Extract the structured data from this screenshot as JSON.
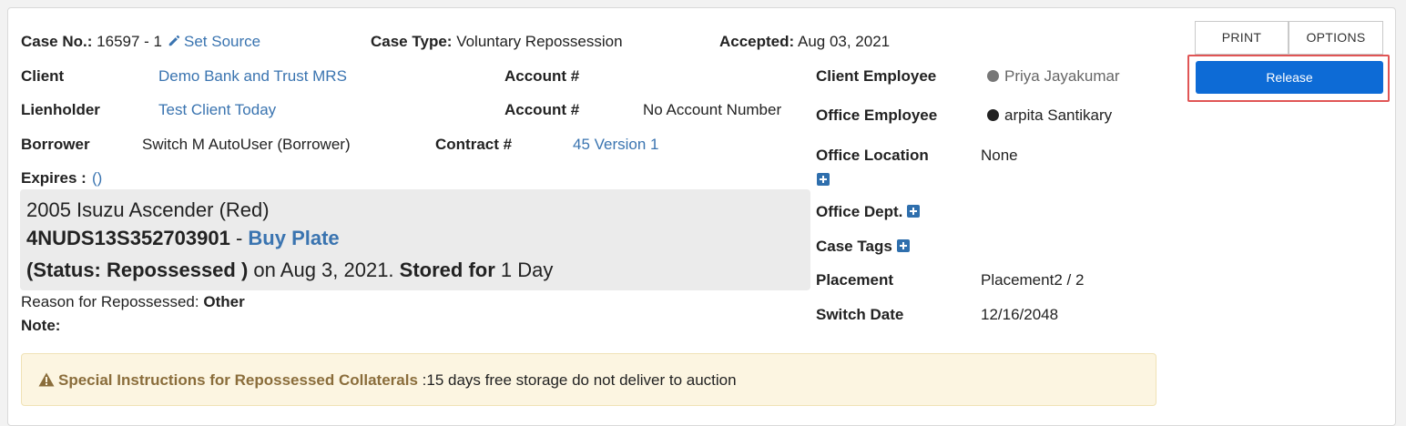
{
  "case": {
    "case_no_label": "Case No.:",
    "case_no_value": "16597 - 1",
    "set_source_label": "Set Source",
    "case_type_label": "Case Type:",
    "case_type_value": "Voluntary Repossession",
    "accepted_label": "Accepted:",
    "accepted_value": "Aug 03, 2021"
  },
  "left": {
    "client_label": "Client",
    "client_value": "Demo Bank and Trust MRS",
    "lienholder_label": "Lienholder",
    "lienholder_value": "Test Client Today",
    "borrower_label": "Borrower",
    "borrower_value": "Switch M AutoUser (Borrower)",
    "expires_label": "Expires :",
    "expires_value": "()"
  },
  "middle": {
    "account1_label": "Account #",
    "account1_value": "",
    "account2_label": "Account #",
    "account2_value": "No Account Number",
    "contract_label": "Contract #",
    "contract_value": "45 Version 1"
  },
  "vehicle": {
    "title": "2005 Isuzu Ascender (Red)",
    "vin": "4NUDS13S352703901",
    "dash": " - ",
    "buy_plate": "Buy Plate",
    "status": "(Status: Repossessed )",
    "on_date": " on Aug 3, 2021. ",
    "stored_label": "Stored for",
    "stored_value": " 1 Day"
  },
  "reason": {
    "label": "Reason for Repossessed:",
    "value": "Other",
    "note_label": "Note:"
  },
  "right": {
    "client_employee_label": "Client Employee",
    "client_employee_value": "Priya Jayakumar",
    "office_employee_label": "Office Employee",
    "office_employee_value": "arpita Santikary",
    "office_location_label": "Office Location",
    "office_location_value": "None",
    "office_dept_label": "Office Dept.",
    "case_tags_label": "Case Tags",
    "placement_label": "Placement",
    "placement_value": "Placement2 / 2",
    "switch_date_label": "Switch Date",
    "switch_date_value": "12/16/2048"
  },
  "actions": {
    "print_label": "PRINT",
    "options_label": "OPTIONS",
    "release_label": "Release"
  },
  "instructions": {
    "title": "Special Instructions for Repossessed Collaterals",
    "text": " :15 days free storage do not deliver to auction"
  },
  "colors": {
    "link": "#3a74b0",
    "primary": "#0d6bd6",
    "highlight_border": "#e05555",
    "warning_text": "#8a6d3b",
    "warning_bg": "#fcf5e1"
  },
  "icons": {
    "set_source": "pencil-icon",
    "add": "plus-square-icon",
    "warning": "warning-icon",
    "client_employee_status": "gray-dot-icon",
    "office_employee_status": "black-dot-icon"
  }
}
